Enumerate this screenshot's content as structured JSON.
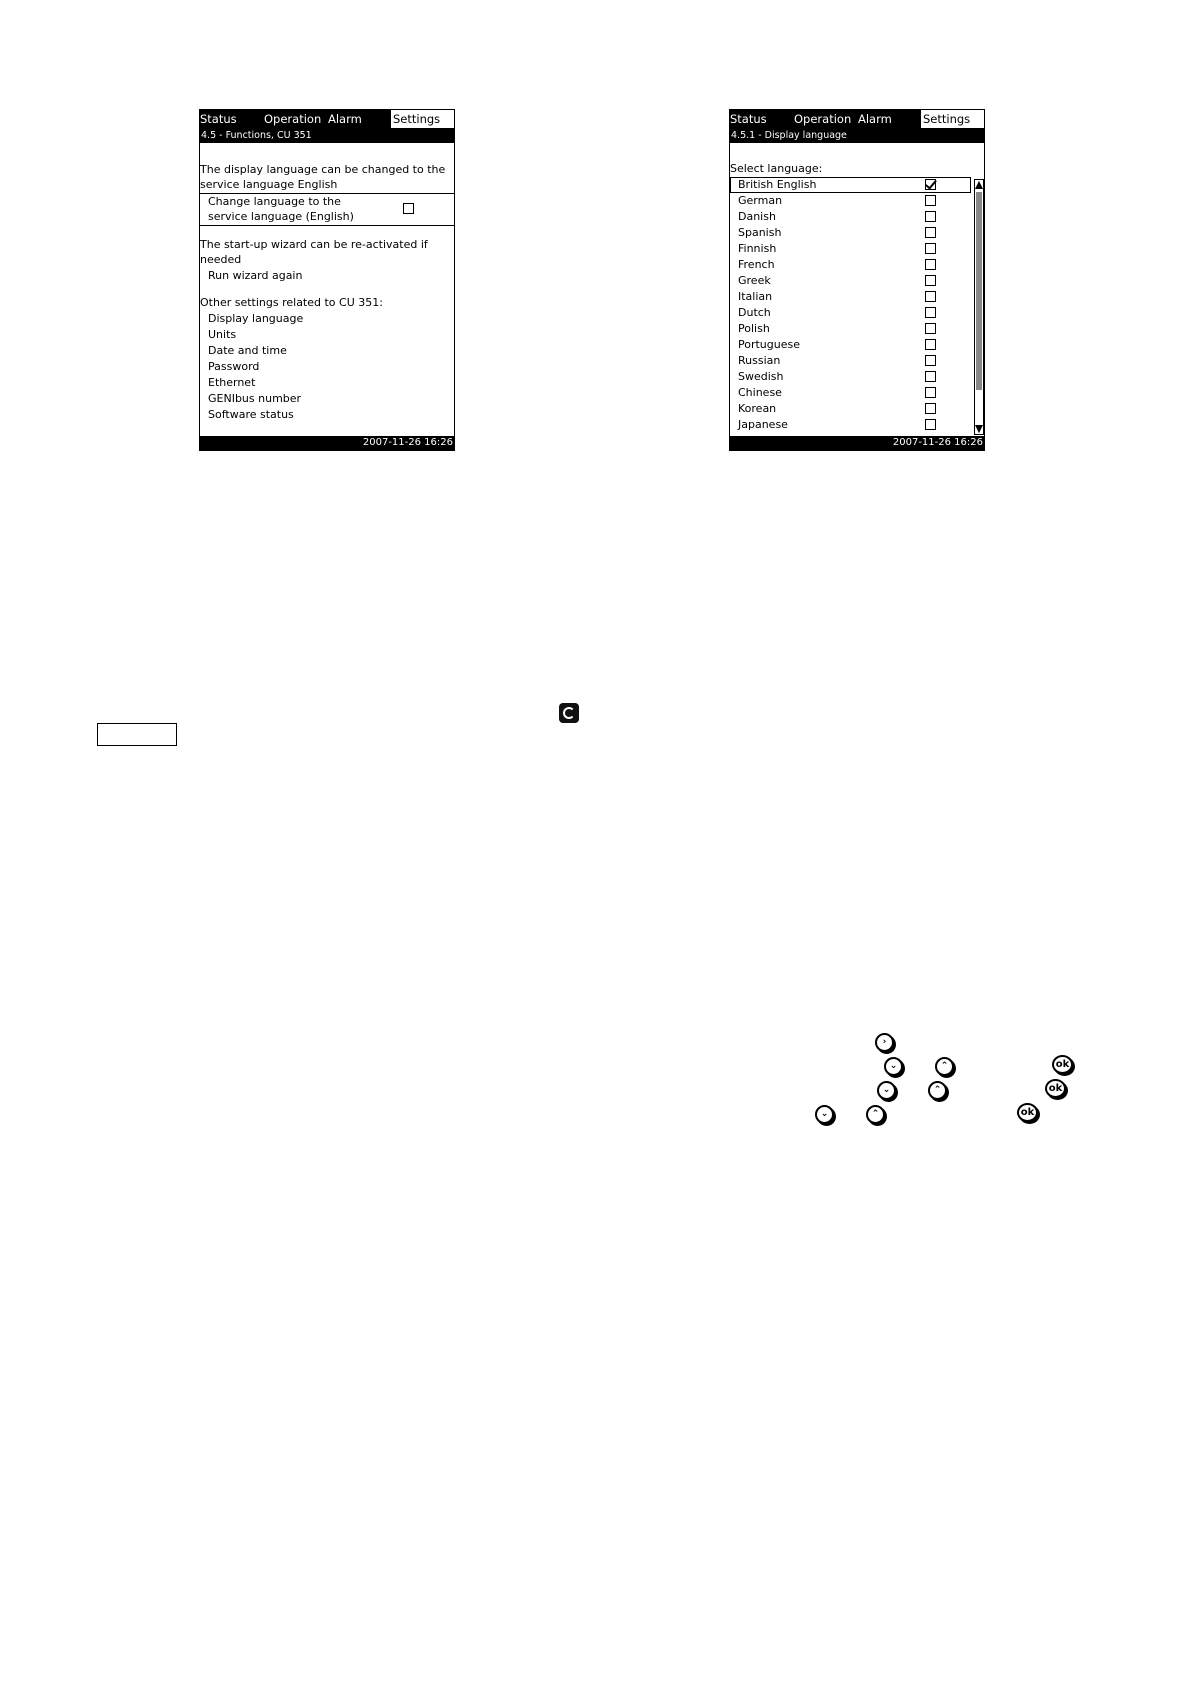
{
  "tabs": [
    "Status",
    "Operation",
    "Alarm",
    "Settings"
  ],
  "left_screen": {
    "title": "4.5 - Functions, CU 351",
    "intro_line1": "The display language can be changed to the",
    "intro_line2": "service language English",
    "change_label_line1": "Change language to the",
    "change_label_line2": "service language (English)",
    "wizard_line1": "The start-up wizard can be re-activated if",
    "wizard_line2": "needed",
    "run_wizard": "Run wizard again",
    "other_heading": "Other settings related to CU 351:",
    "other_items": [
      "Display language",
      "Units",
      "Date and time",
      "Password",
      "Ethernet",
      "GENIbus number",
      "Software status"
    ],
    "footer": "2007-11-26  16:26"
  },
  "right_screen": {
    "title": "4.5.1 - Display language",
    "select_label": "Select language:",
    "languages": [
      "British English",
      "German",
      "Danish",
      "Spanish",
      "Finnish",
      "French",
      "Greek",
      "Italian",
      "Dutch",
      "Polish",
      "Portuguese",
      "Russian",
      "Swedish",
      "Chinese",
      "Korean",
      "Japanese"
    ],
    "selected_language": "British English",
    "footer": "2007-11-26  16:26"
  },
  "keys": {
    "right_arrow": "›",
    "down_arrow": "⌄",
    "up_arrow": "⌃",
    "ok": "ok"
  },
  "icons": {
    "loose_icon": "service-wrench-icon"
  }
}
